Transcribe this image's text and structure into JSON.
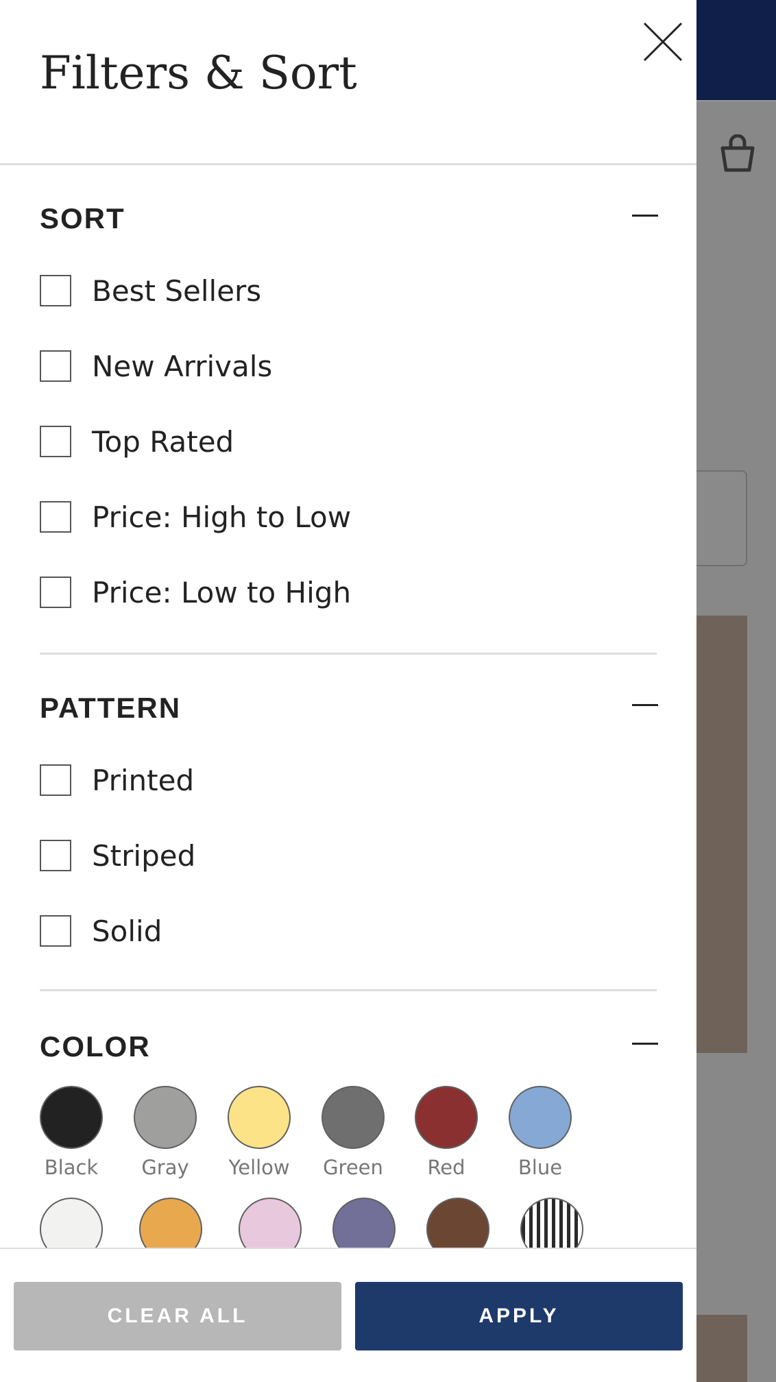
{
  "drawer": {
    "title": "Filters & Sort",
    "close_icon": "close-icon"
  },
  "sort": {
    "heading": "SORT",
    "collapse_icon": "minus-icon",
    "options": [
      "Best Sellers",
      "New Arrivals",
      "Top Rated",
      "Price: High to Low",
      "Price: Low to High"
    ]
  },
  "pattern": {
    "heading": "PATTERN",
    "collapse_icon": "minus-icon",
    "options": [
      "Printed",
      "Striped",
      "Solid"
    ]
  },
  "color": {
    "heading": "COLOR",
    "collapse_icon": "minus-icon",
    "swatches": [
      {
        "label": "Black",
        "hex": "#222222"
      },
      {
        "label": "Gray",
        "hex": "#9f9f9d"
      },
      {
        "label": "Yellow",
        "hex": "#fce388"
      },
      {
        "label": "Green",
        "hex": "#6f6f6f"
      },
      {
        "label": "Red",
        "hex": "#8b3030"
      },
      {
        "label": "Blue",
        "hex": "#86a8d4"
      }
    ],
    "swatches_row2": [
      {
        "hex": "#f2f2f0"
      },
      {
        "hex": "#e8a84e"
      },
      {
        "hex": "#e8c8dc"
      },
      {
        "hex": "#727098"
      },
      {
        "hex": "#6b4733"
      },
      {
        "pattern": "stripes"
      }
    ]
  },
  "footer": {
    "clear_label": "CLEAR ALL",
    "apply_label": "APPLY"
  },
  "colors": {
    "header_navy": "#0f1f4a",
    "apply_button": "#1e3a6b",
    "clear_button": "#b7b7b7",
    "overlay": "#888888"
  },
  "background": {
    "bag_icon": "shopping-bag-icon"
  }
}
